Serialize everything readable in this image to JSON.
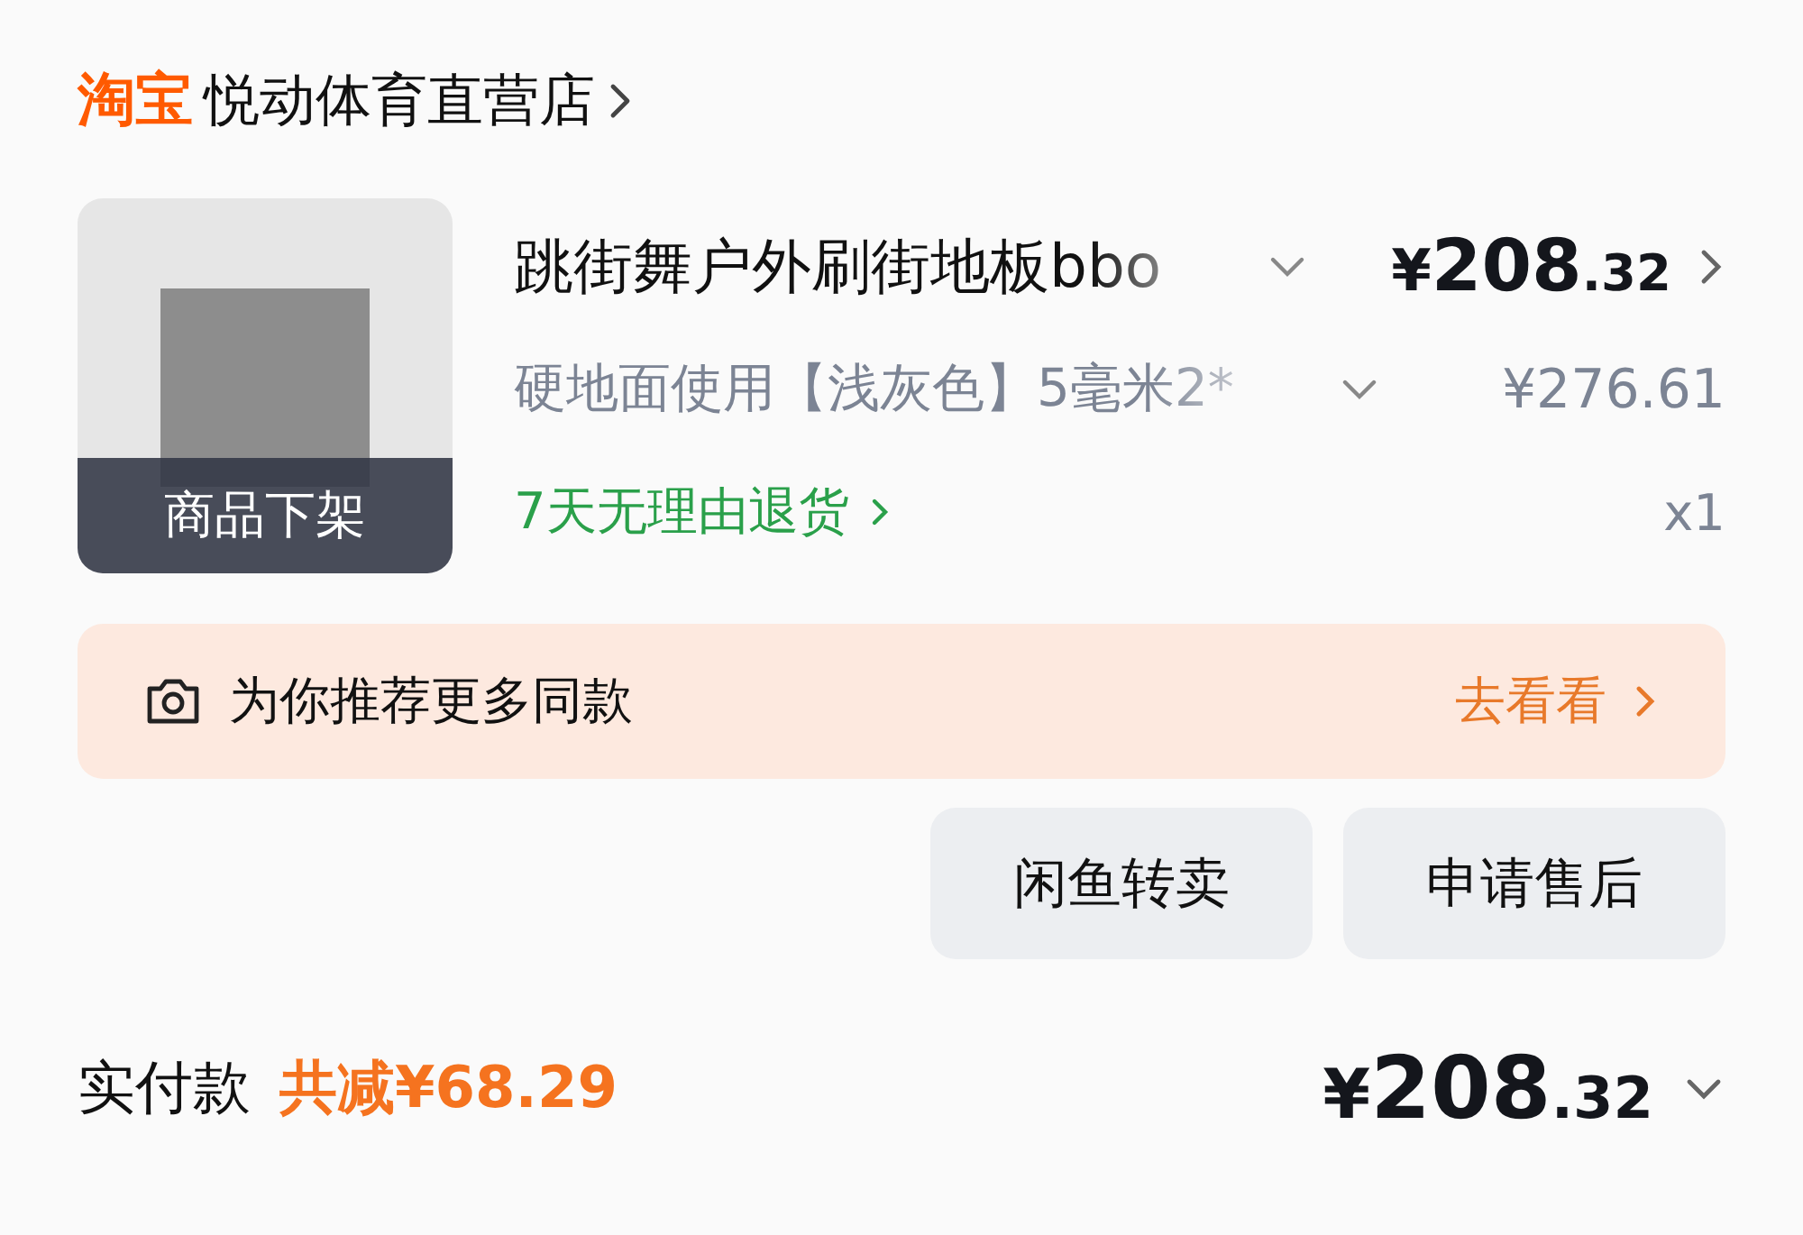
{
  "shop": {
    "brand": "淘宝",
    "name": "悦动体育直营店"
  },
  "item": {
    "badge": "商品下架",
    "title": "跳街舞户外刷街地板bbo",
    "price": {
      "symbol": "¥",
      "integer": "208",
      "decimal": ".32"
    },
    "spec": "硬地面使用【浅灰色】5毫米2*",
    "original_price": "¥276.61",
    "service": "7天无理由退货",
    "quantity": "x1"
  },
  "recommend": {
    "text": "为你推荐更多同款",
    "action": "去看看"
  },
  "buttons": [
    "闲鱼转卖",
    "申请售后"
  ],
  "total": {
    "label": "实付款",
    "discount": "共减¥68.29",
    "price": {
      "symbol": "¥",
      "integer": "208",
      "decimal": ".32"
    }
  }
}
